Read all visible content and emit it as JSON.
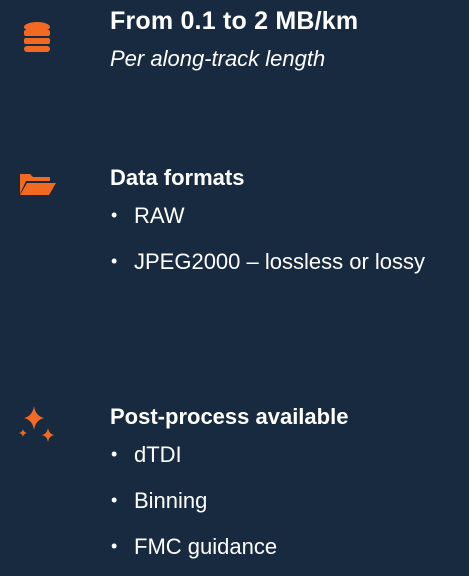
{
  "accent_color": "#f26a21",
  "background_color": "#172a40",
  "sections": [
    {
      "icon": "database-icon",
      "title": "From 0.1 to 2 MB/km",
      "subtitle": "Per along-track length"
    },
    {
      "icon": "folder-open-icon",
      "title": "Data formats",
      "items": [
        "RAW",
        "JPEG2000 – lossless  or lossy"
      ]
    },
    {
      "icon": "sparkles-icon",
      "title": "Post-process available",
      "items": [
        "dTDI",
        "Binning",
        "FMC guidance"
      ]
    }
  ]
}
